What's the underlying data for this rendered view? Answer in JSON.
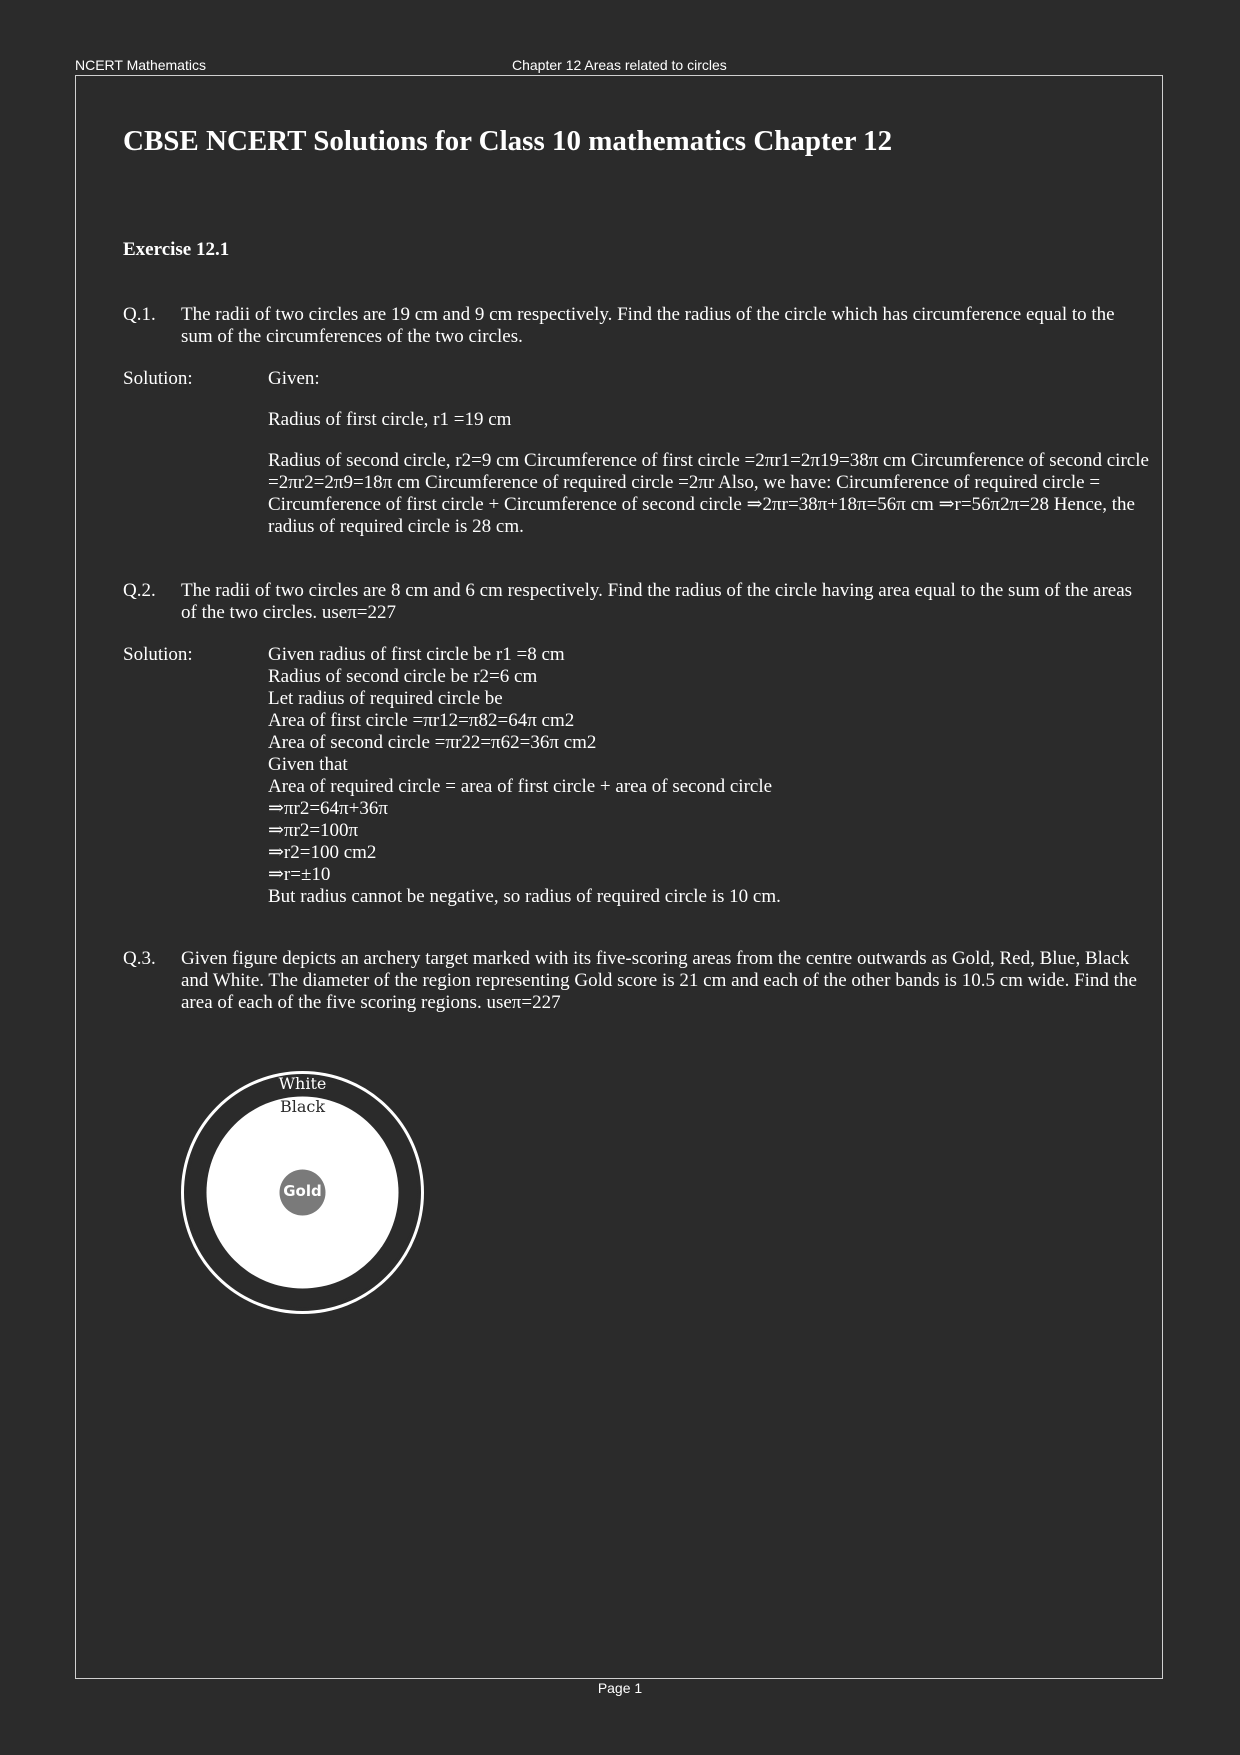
{
  "header": {
    "left": "NCERT Mathematics",
    "center": "Chapter 12 Areas related to circles"
  },
  "title": "CBSE NCERT Solutions for Class 10 mathematics Chapter 12",
  "exercise": "Exercise 12.1",
  "questions": [
    {
      "number": "Q.1.",
      "text": "The radii of two circles are 19 cm and 9 cm respectively. Find the radius of the circle which has circumference equal to the sum of the circumferences of the two circles.",
      "solution_label": "Solution:",
      "solution": [
        "Given:",
        "Radius of first circle, r1 =19 cm",
        "Radius of second circle, r2=9 cm Circumference of first circle =2πr1=2π19=38π cm Circumference of second circle =2πr2=2π9=18π cm Circumference of required circle =2πr Also, we have: Circumference of required circle = Circumference of first circle + Circumference of second circle ⇒2πr=38π+18π=56π cm ⇒r=56π2π=28 Hence, the radius of required circle is 28 cm."
      ]
    },
    {
      "number": "Q.2.",
      "text": "The radii of two circles are 8 cm and 6 cm respectively. Find the radius of the circle having area equal to the sum of the areas of the two circles. useπ=227",
      "solution_label": "Solution:",
      "solution_lines": [
        "Given radius of first circle be r1 =8 cm",
        "Radius of second circle be r2=6 cm",
        "Let radius of required circle be",
        "Area of first circle  =πr12=π82=64π cm2",
        "Area of second circle =πr22=π62=36π cm2",
        "Given that",
        "Area of required circle = area of first circle + area of second circle",
        "⇒πr2=64π+36π",
        "⇒πr2=100π",
        "⇒r2=100 cm2",
        "⇒r=±10",
        "But radius cannot be negative, so radius of required circle is 10 cm."
      ]
    },
    {
      "number": "Q.3.",
      "text": "Given figure depicts an archery target marked with its five-scoring areas from the centre outwards as Gold, Red, Blue, Black and White. The diameter of the region representing Gold score is 21 cm and each of the other bands is 10.5 cm wide. Find the area of each of the five scoring regions. useπ=227"
    }
  ],
  "figure": {
    "white_label": "White",
    "black_label": "Black",
    "gold_label": "Gold",
    "colors": {
      "background": "#2b2b2b",
      "white": "#ffffff",
      "black": "#2b2b2b",
      "gold": "#7a7a7a"
    }
  },
  "footer": "Page 1"
}
